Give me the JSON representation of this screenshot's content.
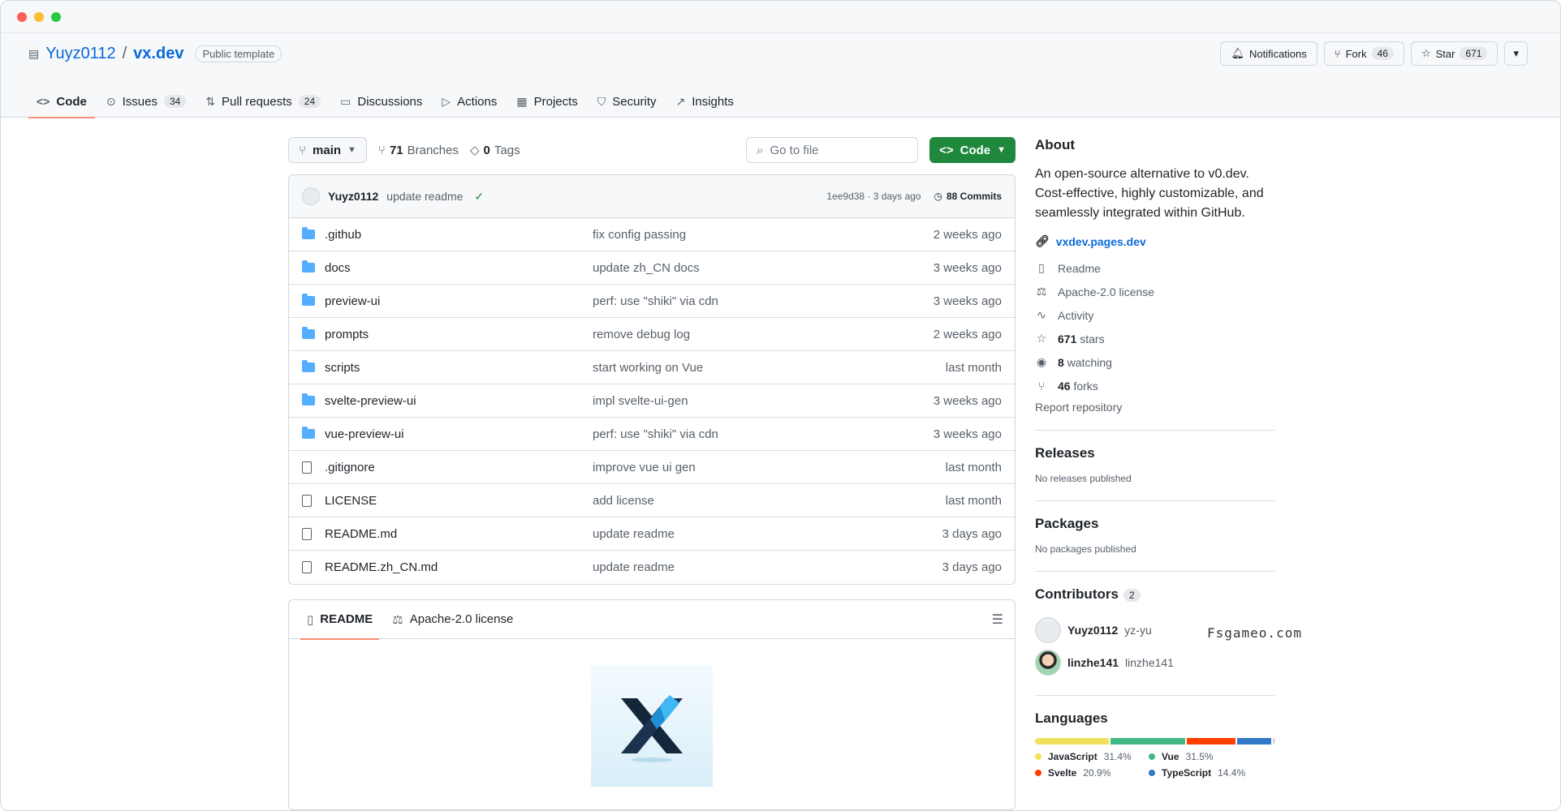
{
  "repo": {
    "owner": "Yuyz0112",
    "separator": "/",
    "name": "vx.dev",
    "visibility": "Public template"
  },
  "header_actions": {
    "notifications": "Notifications",
    "fork_label": "Fork",
    "fork_count": "46",
    "star_label": "Star",
    "star_count": "671"
  },
  "tabs": [
    {
      "label": "Code",
      "icon": "code-icon"
    },
    {
      "label": "Issues",
      "count": "34",
      "icon": "issue-icon"
    },
    {
      "label": "Pull requests",
      "count": "24",
      "icon": "pull-request-icon"
    },
    {
      "label": "Discussions",
      "icon": "discussions-icon"
    },
    {
      "label": "Actions",
      "icon": "play-icon"
    },
    {
      "label": "Projects",
      "icon": "table-icon"
    },
    {
      "label": "Security",
      "icon": "shield-icon"
    },
    {
      "label": "Insights",
      "icon": "graph-icon"
    }
  ],
  "toolbar": {
    "branch": "main",
    "branches_count": "71",
    "branches_label": "Branches",
    "tags_count": "0",
    "tags_label": "Tags",
    "search_placeholder": "Go to file",
    "code_button": "Code"
  },
  "latest_commit": {
    "author": "Yuyz0112",
    "message": "update readme",
    "hash_time": "1ee9d38 · 3 days ago",
    "commits_label": "88 Commits"
  },
  "files": [
    {
      "name": ".github",
      "type": "folder",
      "message": "fix config passing",
      "time": "2 weeks ago"
    },
    {
      "name": "docs",
      "type": "folder",
      "message": "update zh_CN docs",
      "time": "3 weeks ago"
    },
    {
      "name": "preview-ui",
      "type": "folder",
      "message": "perf: use \"shiki\" via cdn",
      "time": "3 weeks ago"
    },
    {
      "name": "prompts",
      "type": "folder",
      "message": "remove debug log",
      "time": "2 weeks ago"
    },
    {
      "name": "scripts",
      "type": "folder",
      "message": "start working on Vue",
      "time": "last month"
    },
    {
      "name": "svelte-preview-ui",
      "type": "folder",
      "message": "impl svelte-ui-gen",
      "time": "3 weeks ago"
    },
    {
      "name": "vue-preview-ui",
      "type": "folder",
      "message": "perf: use \"shiki\" via cdn",
      "time": "3 weeks ago"
    },
    {
      "name": ".gitignore",
      "type": "file",
      "message": "improve vue ui gen",
      "time": "last month"
    },
    {
      "name": "LICENSE",
      "type": "file",
      "message": "add license",
      "time": "last month"
    },
    {
      "name": "README.md",
      "type": "file",
      "message": "update readme",
      "time": "3 days ago"
    },
    {
      "name": "README.zh_CN.md",
      "type": "file",
      "message": "update readme",
      "time": "3 days ago"
    }
  ],
  "readme_tabs": {
    "readme": "README",
    "license": "Apache-2.0 license"
  },
  "about": {
    "heading": "About",
    "description": "An open-source alternative to v0.dev. Cost-effective, highly customizable, and seamlessly integrated within GitHub.",
    "website": "vxdev.pages.dev",
    "readme": "Readme",
    "license": "Apache-2.0 license",
    "activity": "Activity",
    "stars_count": "671",
    "stars_label": "stars",
    "watching_count": "8",
    "watching_label": "watching",
    "forks_count": "46",
    "forks_label": "forks",
    "report": "Report repository"
  },
  "releases": {
    "heading": "Releases",
    "note": "No releases published"
  },
  "packages": {
    "heading": "Packages",
    "note": "No packages published"
  },
  "contributors": {
    "heading": "Contributors",
    "count": "2",
    "list": [
      {
        "name": "Yuyz0112",
        "login": "yz-yu"
      },
      {
        "name": "linzhe141",
        "login": "linzhe141"
      }
    ]
  },
  "languages": {
    "heading": "Languages",
    "items": [
      {
        "name": "JavaScript",
        "percent": "31.4%",
        "value": 31.4,
        "color": "#f1e05a"
      },
      {
        "name": "Vue",
        "percent": "31.5%",
        "value": 31.5,
        "color": "#41b883"
      },
      {
        "name": "Svelte",
        "percent": "20.9%",
        "value": 20.9,
        "color": "#ff3e00"
      },
      {
        "name": "TypeScript",
        "percent": "14.4%",
        "value": 14.4,
        "color": "#3178c6"
      }
    ]
  },
  "watermark": "Fsgameo.com"
}
